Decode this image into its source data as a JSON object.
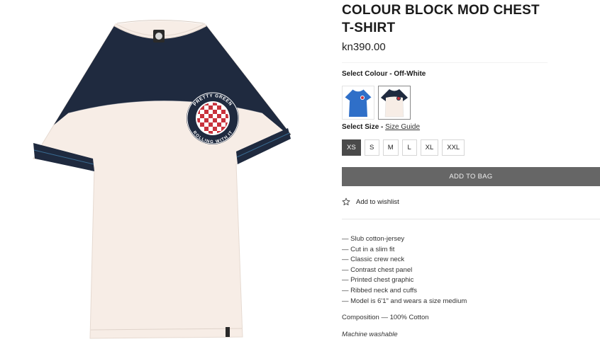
{
  "product": {
    "title": "COLOUR BLOCK MOD CHEST T-SHIRT",
    "price": "kn390.00"
  },
  "colour": {
    "label": "Select Colour - ",
    "selected": "Off-White",
    "swatches": [
      {
        "name": "Blue",
        "color": "#2f6fc8"
      },
      {
        "name": "Off-White",
        "color": "#f7ede6",
        "panel": "#1f2a3f"
      }
    ]
  },
  "size": {
    "label": "Select Size - ",
    "guide_link": "Size Guide",
    "options": [
      "XS",
      "S",
      "M",
      "L",
      "XL",
      "XXL"
    ],
    "selected": "XS"
  },
  "actions": {
    "add_to_bag": "ADD TO BAG",
    "wishlist": "Add to wishlist"
  },
  "description": {
    "features": [
      "— Slub cotton-jersey",
      "— Cut in a slim fit",
      "— Classic crew neck",
      "— Contrast chest panel",
      "— Printed chest graphic",
      "— Ribbed neck and cuffs",
      "— Model is 6'1\" and wears a size medium"
    ],
    "composition": "Composition — 100% Cotton",
    "care": "Machine washable"
  },
  "image": {
    "badge_top_text": "PRETTY GREEN",
    "badge_bottom_text": "ROLLING WITH IT",
    "colors": {
      "body": "#f7ede6",
      "panel": "#1f2a3f",
      "badge_red": "#c8323c"
    }
  }
}
